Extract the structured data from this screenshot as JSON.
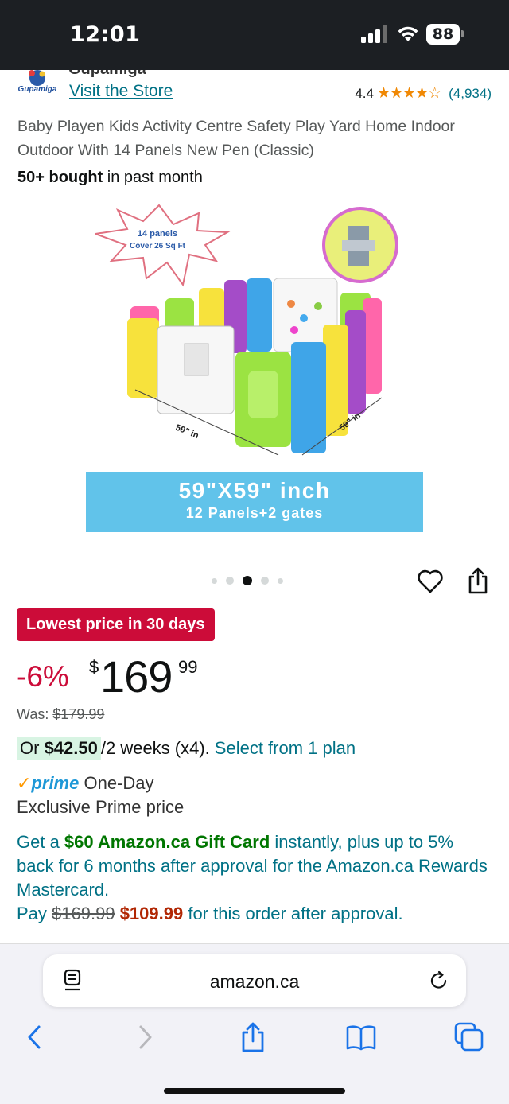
{
  "status_bar": {
    "time": "12:01",
    "battery": "88"
  },
  "brand": {
    "name": "Gupamiga",
    "logo_text": "Gupamiga",
    "visit_store": "Visit the Store"
  },
  "rating": {
    "value": "4.4",
    "stars": "★★★★☆",
    "count": "(4,934)"
  },
  "product": {
    "title": "Baby Playen Kids Activity Centre Safety Play Yard Home Indoor Outdoor With 14 Panels New Pen (Classic)",
    "bought_bold": "50+ bought",
    "bought_rest": " in past month"
  },
  "image": {
    "burst_line1": "14  panels",
    "burst_line2": "Cover 26 Sq Ft",
    "dim_left": "59\" in",
    "dim_right": "59\" in",
    "banner_line1": "59\"X59\"  inch",
    "banner_line2": "12 Panels+2 gates"
  },
  "carousel": {
    "count": 5,
    "active_index": 2
  },
  "badge": "Lowest price in 30 days",
  "price": {
    "discount": "-6%",
    "currency": "$",
    "whole": "169",
    "fraction": "99",
    "was_label": "Was: ",
    "was_value": "$179.99"
  },
  "installment": {
    "or": "Or ",
    "amount": "$42.50",
    "period": " /2 weeks (x4). ",
    "select": "Select from 1 plan"
  },
  "prime": {
    "check": "✓",
    "word": "prime",
    "delivery": " One-Day",
    "exclusive": "Exclusive Prime price"
  },
  "promo": {
    "p1": "Get a ",
    "gift": "$60 Amazon.ca Gift Card",
    "p2": " instantly, plus up to 5% back for 6 months after approval for the Amazon.ca Rewards Mastercard.",
    "pay": "Pay ",
    "old_price": "$169.99",
    "new_price": "$109.99",
    "p3": " for this order after approval."
  },
  "browser": {
    "url": "amazon.ca"
  },
  "colors": {
    "link": "#007185",
    "deal_red": "#cc0c39",
    "star_orange": "#f08804",
    "prime_blue": "#1e98d7",
    "banner_blue": "#61c3ea"
  }
}
